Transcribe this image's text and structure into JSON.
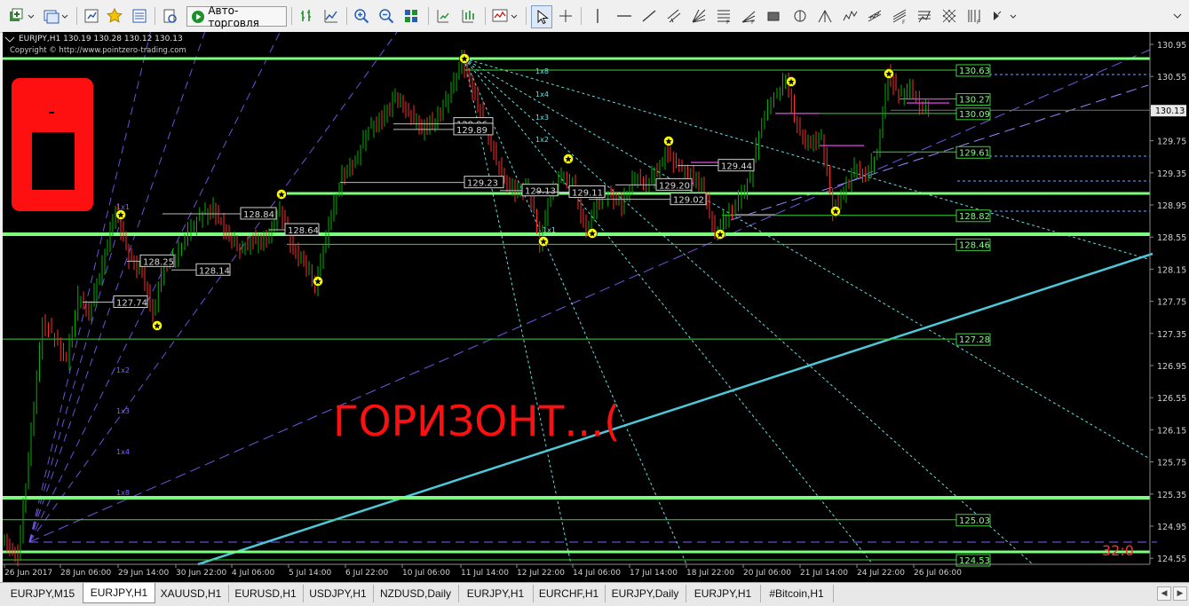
{
  "toolbar": {
    "auto_trading_label": "Авто-торговля",
    "icons": [
      "new-chart-icon",
      "profiles-icon",
      "market-watch-icon",
      "navigator-icon",
      "data-window-icon",
      "strategy-tester-icon",
      "auto-trading-icon",
      "bar-chart-icon",
      "candles-icon",
      "line-chart-icon",
      "zoom-in-icon",
      "zoom-out-icon",
      "tile-windows-icon",
      "chart-shift-icon",
      "autoscroll-icon",
      "period-icon",
      "indicators-icon",
      "cursor-icon",
      "crosshair-icon",
      "vertical-line-icon",
      "horizontal-line-icon",
      "trendline-icon",
      "channel-icon",
      "gann-fan-icon",
      "fibo-icon",
      "rectangle-icon",
      "text-icon",
      "arrow-icon",
      "objects-icon"
    ]
  },
  "chart": {
    "symbol_line": "EURJPY,H1  130.19 130.28 130.12 130.13",
    "copyright": "Copyright © http://www.pointzero-trading.com",
    "annotation": "ГОРИЗОНТ...(",
    "timer": "32:0",
    "current_price": "130.13",
    "colors": {
      "background": "#000000",
      "bull": "#00b000",
      "bear": "#ff2a2a",
      "level": "#7cff7c",
      "fan": "#60e0e0",
      "gann": "#8060ff",
      "annotation": "#ff1010",
      "star": "#ffff00"
    }
  },
  "price_axis": [
    "130.95",
    "130.55",
    "130.15",
    "129.75",
    "129.35",
    "128.95",
    "128.55",
    "128.15",
    "127.75",
    "127.35",
    "126.95",
    "126.55",
    "126.15",
    "125.75",
    "125.35",
    "124.95",
    "124.55"
  ],
  "time_axis": [
    "26 Jun 2017",
    "28 Jun 06:00",
    "29 Jun 14:00",
    "30 Jun 22:00",
    "4 Jul 06:00",
    "5 Jul 14:00",
    "6 Jul 22:00",
    "10 Jul 06:00",
    "11 Jul 14:00",
    "12 Jul 22:00",
    "14 Jul 06:00",
    "17 Jul 14:00",
    "18 Jul 22:00",
    "20 Jul 06:00",
    "21 Jul 14:00",
    "24 Jul 22:00",
    "26 Jul 06:00"
  ],
  "level_labels": [
    "130.63",
    "130.27",
    "130.09",
    "129.61",
    "128.82",
    "128.46",
    "127.28",
    "125.03",
    "124.53"
  ],
  "box_labels": [
    "129.96",
    "129.89",
    "129.23",
    "128.84",
    "128.64",
    "128.25",
    "128.14",
    "127.74",
    "129.44",
    "129.20",
    "129.02",
    "129.13",
    "129.11"
  ],
  "fan_labels": [
    "1x8",
    "1x4",
    "1x3",
    "1x2",
    "1x1"
  ],
  "gann_labels": [
    "1x1",
    "1x2",
    "1x3",
    "1x4",
    "1x8"
  ],
  "tabs": [
    "EURJPY,M15",
    "EURJPY,H1",
    "XAUUSD,H1",
    "EURUSD,H1",
    "USDJPY,H1",
    "NZDUSD,Daily",
    "EURJPY,H1",
    "EURCHF,H1",
    "EURJPY,Daily",
    "EURJPY,H1",
    "#Bitcoin,H1"
  ],
  "active_tab": "EURJPY,H1"
}
